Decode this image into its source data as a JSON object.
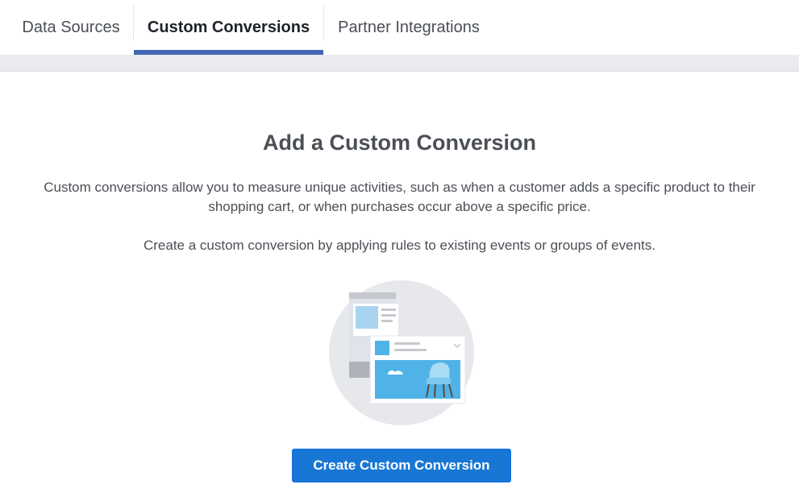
{
  "tabs": [
    {
      "label": "Data Sources",
      "active": false
    },
    {
      "label": "Custom Conversions",
      "active": true
    },
    {
      "label": "Partner Integrations",
      "active": false
    }
  ],
  "main": {
    "title": "Add a Custom Conversion",
    "description": "Custom conversions allow you to measure unique activities, such as when a customer adds a specific product to their shopping cart, or when purchases occur above a specific price.",
    "instruction": "Create a custom conversion by applying rules to existing events or groups of events.",
    "illustration_icon": "custom-conversion-illustration",
    "cta_label": "Create Custom Conversion"
  },
  "colors": {
    "accent": "#4267b2",
    "button": "#1877d4",
    "text": "#4b4f56",
    "band": "#e9ebee"
  }
}
